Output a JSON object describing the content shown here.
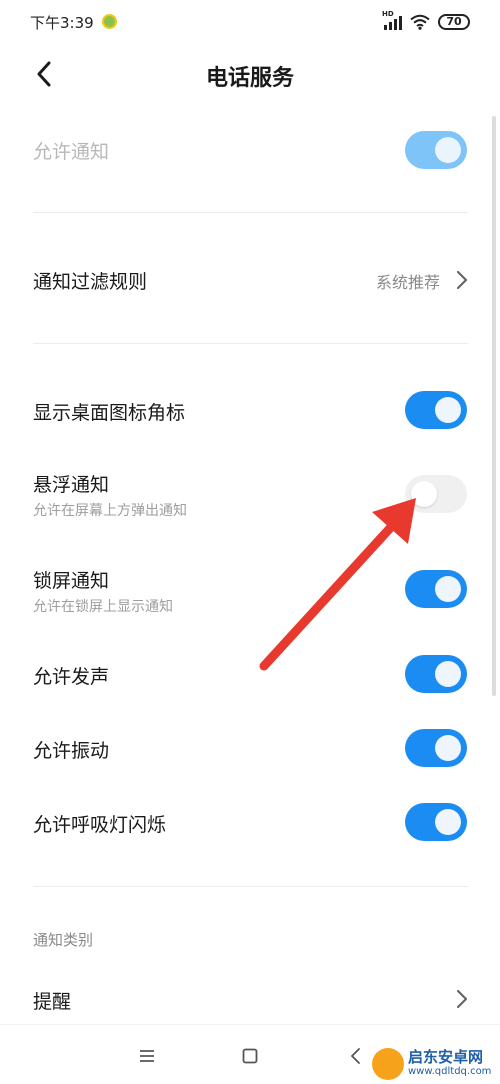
{
  "status_bar": {
    "time": "下午3:39",
    "network_badge": "HD",
    "battery": "70",
    "icons": [
      "app-notification-icon",
      "signal-icon",
      "wifi-icon",
      "battery-icon"
    ]
  },
  "header": {
    "title": "电话服务",
    "back_icon": "chevron-left-icon"
  },
  "settings": {
    "allow_notifications": {
      "label": "允许通知",
      "enabled": true,
      "disabled_state": true
    },
    "filter_rules": {
      "label": "通知过滤规则",
      "value": "系统推荐"
    },
    "badge": {
      "label": "显示桌面图标角标",
      "enabled": true
    },
    "floating": {
      "label": "悬浮通知",
      "sublabel": "允许在屏幕上方弹出通知",
      "enabled": false
    },
    "lockscreen": {
      "label": "锁屏通知",
      "sublabel": "允许在锁屏上显示通知",
      "enabled": true
    },
    "sound": {
      "label": "允许发声",
      "enabled": true
    },
    "vibrate": {
      "label": "允许振动",
      "enabled": true
    },
    "led": {
      "label": "允许呼吸灯闪烁",
      "enabled": true
    }
  },
  "categories": {
    "header": "通知类别",
    "items": [
      {
        "label": "提醒"
      }
    ]
  },
  "system_nav": {
    "keys": [
      "menu-icon",
      "home-icon",
      "back-icon"
    ]
  },
  "watermark": {
    "title": "启东安卓网",
    "url": "www.qdltdq.com"
  },
  "colors": {
    "toggle_on": "#1b8df2",
    "toggle_off": "#f0f0f0",
    "toggle_disabled": "#7ec4f8",
    "annotation_arrow": "#e8392f"
  }
}
